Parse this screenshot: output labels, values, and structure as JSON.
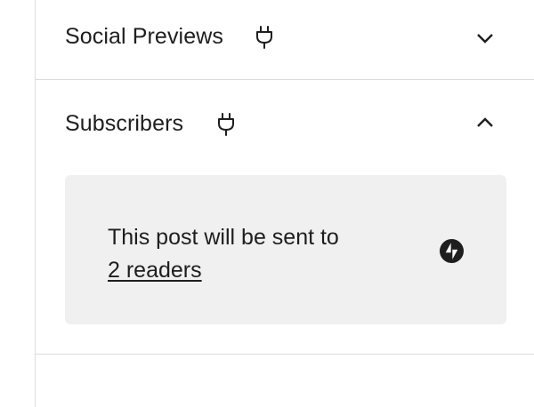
{
  "panels": {
    "social_previews": {
      "title": "Social Previews",
      "plugin_icon": "plug-icon",
      "toggle_icon": "chevron-down-icon",
      "expanded": false
    },
    "subscribers": {
      "title": "Subscribers",
      "plugin_icon": "plug-icon",
      "toggle_icon": "chevron-up-icon",
      "expanded": true,
      "message_prefix": "This post will be sent to",
      "readers_link": "2 readers",
      "brand_icon": "jetpack-icon"
    }
  }
}
